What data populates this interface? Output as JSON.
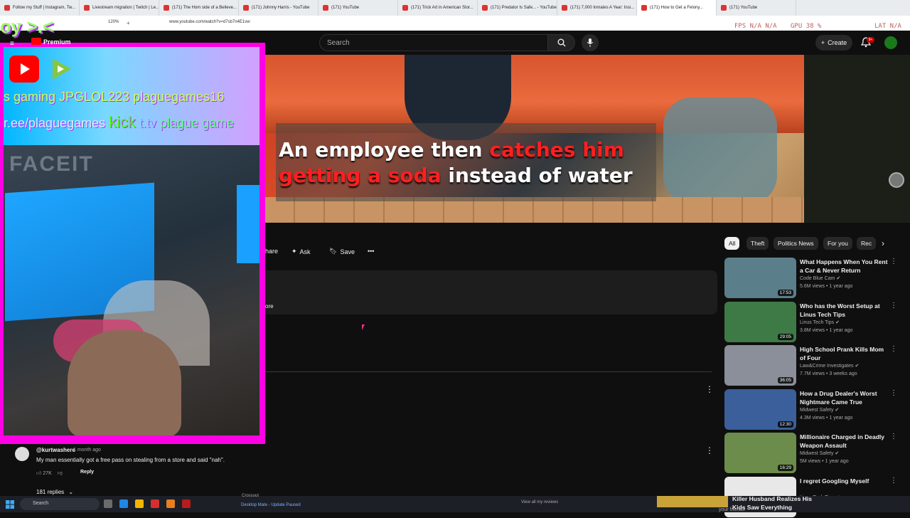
{
  "browser": {
    "tabs": [
      {
        "title": "Follow my Stuff | Instagram, Tw...",
        "active": false
      },
      {
        "title": "Livestream migration | Twitch | Le...",
        "active": false
      },
      {
        "title": "(171) The Hom side of a Believe...",
        "active": false
      },
      {
        "title": "(171) Johnny Harris - YouTube",
        "active": false
      },
      {
        "title": "(171) YouTube",
        "active": false
      },
      {
        "title": "(171) Trick Art in American Stor...",
        "active": false
      },
      {
        "title": "(171) Predator Is Safe... - YouTube",
        "active": false
      },
      {
        "title": "(171) 7,000 Inmates A Year: Insi...",
        "active": false
      },
      {
        "title": "(171) How to Get a Felony...",
        "active": true
      },
      {
        "title": "(171) YouTube",
        "active": false
      }
    ],
    "zoom": "120%",
    "url": "www.youtube.com/watch?v=d7sb7n4E1vw",
    "stats_fps": "FPS N/A N/A",
    "stats_gpu": "GPU 38 %",
    "stats_extra": "LAT N/A"
  },
  "youtube": {
    "logo_text": "Premium",
    "search_placeholder": "Search",
    "create_label": "Create",
    "notif_badge": "9+"
  },
  "video": {
    "caption_part1_white": "An employee then ",
    "caption_part1_red": "catches him",
    "caption_part2_red": "getting a soda",
    "caption_part2_white": " instead of water"
  },
  "actions": {
    "share": "hare",
    "ask": "Ask",
    "save": "Save",
    "more": "ore"
  },
  "overlay": {
    "line1": "s gaming JPGLOL223 plaguegames16",
    "line2a": "r.ee/plaguegames ",
    "line2_kick": "kick",
    "line2_ttv": " t.tv",
    "line2b": " plague game",
    "banner": "FACEIT",
    "title_text": "oy >.<"
  },
  "comment": {
    "user": "@kurtwashere",
    "date": "1 month ago",
    "text": "My man essentially got a free pass on stealing from a store and said \"nah\".",
    "likes": "27K",
    "reply": "Reply",
    "replies": "181 replies"
  },
  "chips": [
    "All",
    "Theft",
    "Politics News",
    "For you",
    "Rec"
  ],
  "recommendations": [
    {
      "title": "What Happens When You Rent a Car & Never Return",
      "channel": "Code Blue Cam",
      "views": "5.6M views",
      "age": "1 year ago",
      "duration": "17:53",
      "thumb_color": "#5a7f8a"
    },
    {
      "title": "Who has the Worst Setup at Linus Tech Tips",
      "channel": "Linus Tech Tips",
      "views": "3.8M views",
      "age": "1 year ago",
      "duration": "29:05",
      "thumb_color": "#3e7a46"
    },
    {
      "title": "High School Prank Kills Mom of Four",
      "channel": "Law&Crime Investigates",
      "views": "7.7M views",
      "age": "3 weeks ago",
      "duration": "36:05",
      "thumb_color": "#8a8f9a"
    },
    {
      "title": "How a Drug Dealer's Worst Nightmare Came True",
      "channel": "Midwest Safety",
      "views": "4.3M views",
      "age": "1 year ago",
      "duration": "12:30",
      "thumb_color": "#3a5f9a"
    },
    {
      "title": "Millionaire Charged in Deadly Weapon Assault",
      "channel": "Midwest Safety",
      "views": "5M views",
      "age": "1 year ago",
      "duration": "16:29",
      "thumb_color": "#6b8c4a"
    },
    {
      "title": "I regret Googling Myself",
      "channel": "Linus Tech Tips",
      "views": "",
      "age": "",
      "duration": "",
      "thumb_color": "#e8e8e8"
    }
  ],
  "taskbar": {
    "search": "Search",
    "item1": "Crossout",
    "item2": "Desktop Mate - Update Paused",
    "item3": "View all my reviews",
    "news1": "Killer Husband Realizes His",
    "news2": "Kids Saw Everything",
    "news3": "your friends"
  }
}
